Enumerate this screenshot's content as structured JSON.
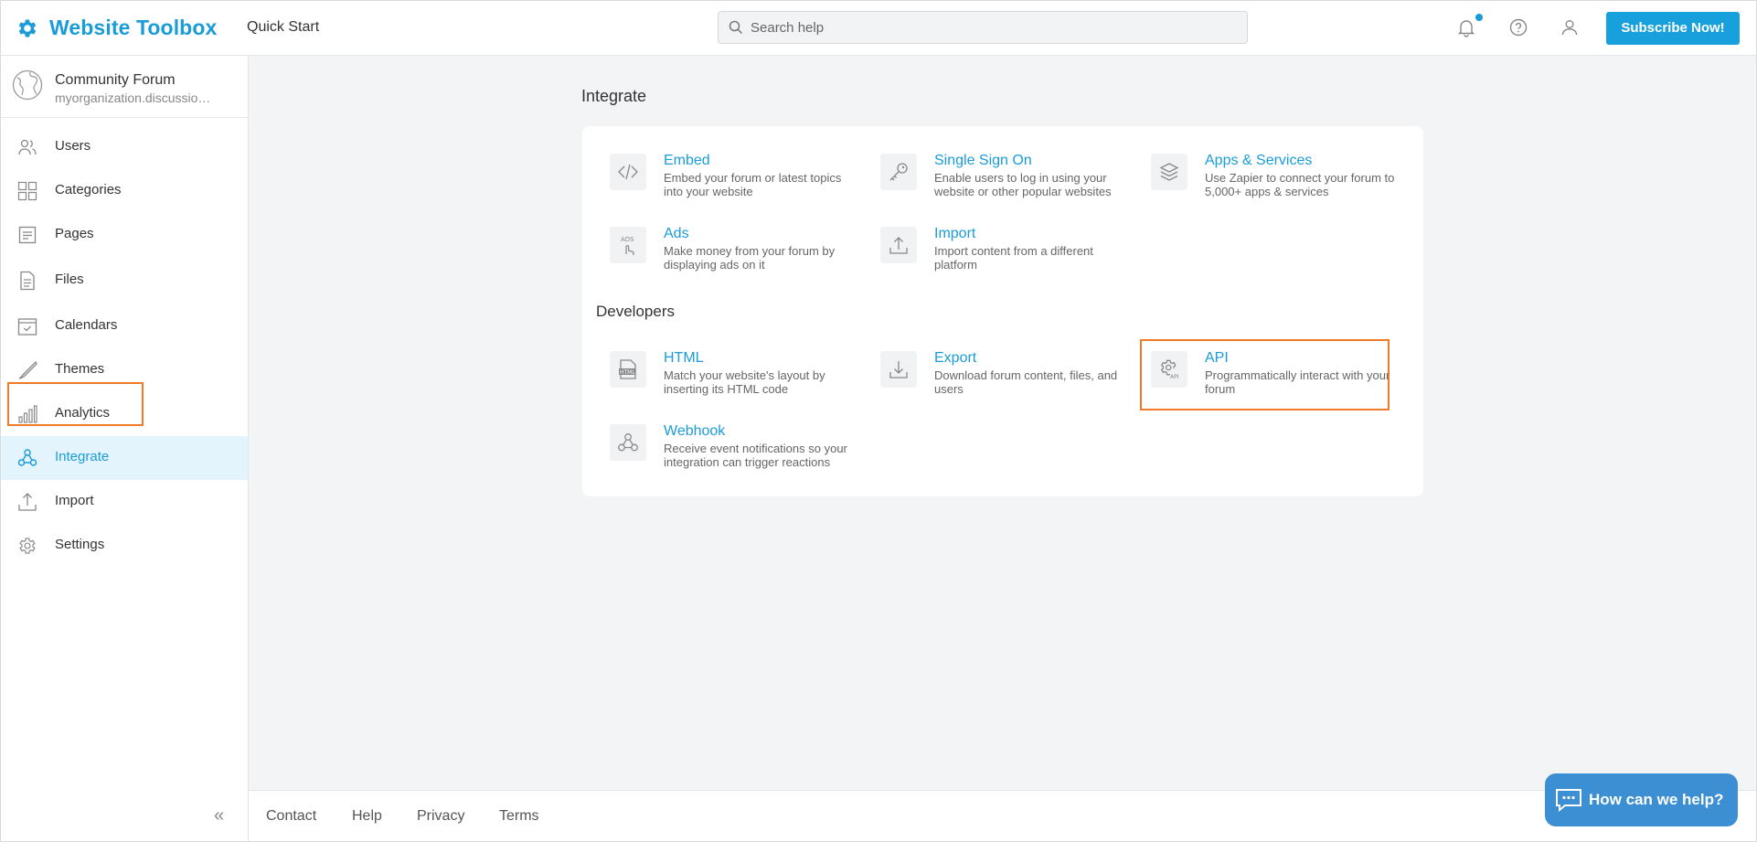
{
  "header": {
    "brand_name": "Website Toolbox",
    "quick_start": "Quick Start",
    "search_placeholder": "Search help",
    "subscribe_label": "Subscribe Now!"
  },
  "sidebar": {
    "forum_name": "Community Forum",
    "forum_url": "myorganization.discussion.community",
    "items": [
      {
        "label": "Users",
        "icon": "users-icon"
      },
      {
        "label": "Categories",
        "icon": "grid-icon"
      },
      {
        "label": "Pages",
        "icon": "page-icon"
      },
      {
        "label": "Files",
        "icon": "file-icon"
      },
      {
        "label": "Calendars",
        "icon": "calendar-icon"
      },
      {
        "label": "Themes",
        "icon": "brush-icon"
      },
      {
        "label": "Analytics",
        "icon": "bar-chart-icon"
      },
      {
        "label": "Integrate",
        "icon": "webhook-icon",
        "active": true
      },
      {
        "label": "Import",
        "icon": "upload-icon"
      },
      {
        "label": "Settings",
        "icon": "gear-icon"
      }
    ],
    "collapse_glyph": "«"
  },
  "main": {
    "integrate_title": "Integrate",
    "developers_title": "Developers",
    "integrate_items": [
      {
        "title": "Embed",
        "desc": "Embed your forum or latest topics into your website",
        "icon": "code-icon"
      },
      {
        "title": "Single Sign On",
        "desc": "Enable users to log in using your website or other popular websites",
        "icon": "key-icon"
      },
      {
        "title": "Apps & Services",
        "desc": "Use Zapier to connect your forum to 5,000+ apps & services",
        "icon": "layers-icon"
      },
      {
        "title": "Ads",
        "desc": "Make money from your forum by displaying ads on it",
        "icon": "ads-icon"
      },
      {
        "title": "Import",
        "desc": "Import content from a different platform",
        "icon": "upload-icon"
      }
    ],
    "developer_items": [
      {
        "title": "HTML",
        "desc": "Match your website's layout by inserting its HTML code",
        "icon": "html-icon"
      },
      {
        "title": "Export",
        "desc": "Download forum content, files, and users",
        "icon": "download-icon"
      },
      {
        "title": "API",
        "desc": "Programmatically interact with your forum",
        "icon": "api-gear-icon"
      },
      {
        "title": "Webhook",
        "desc": "Receive event notifications so your integration can trigger reactions",
        "icon": "webhook-icon"
      }
    ]
  },
  "footer": {
    "links": [
      "Contact",
      "Help",
      "Privacy",
      "Terms"
    ]
  },
  "chat": {
    "label": "How can we help?"
  },
  "colors": {
    "accent": "#1a9cd8",
    "highlight": "#f07a28",
    "active_bg": "#e4f4fc"
  }
}
